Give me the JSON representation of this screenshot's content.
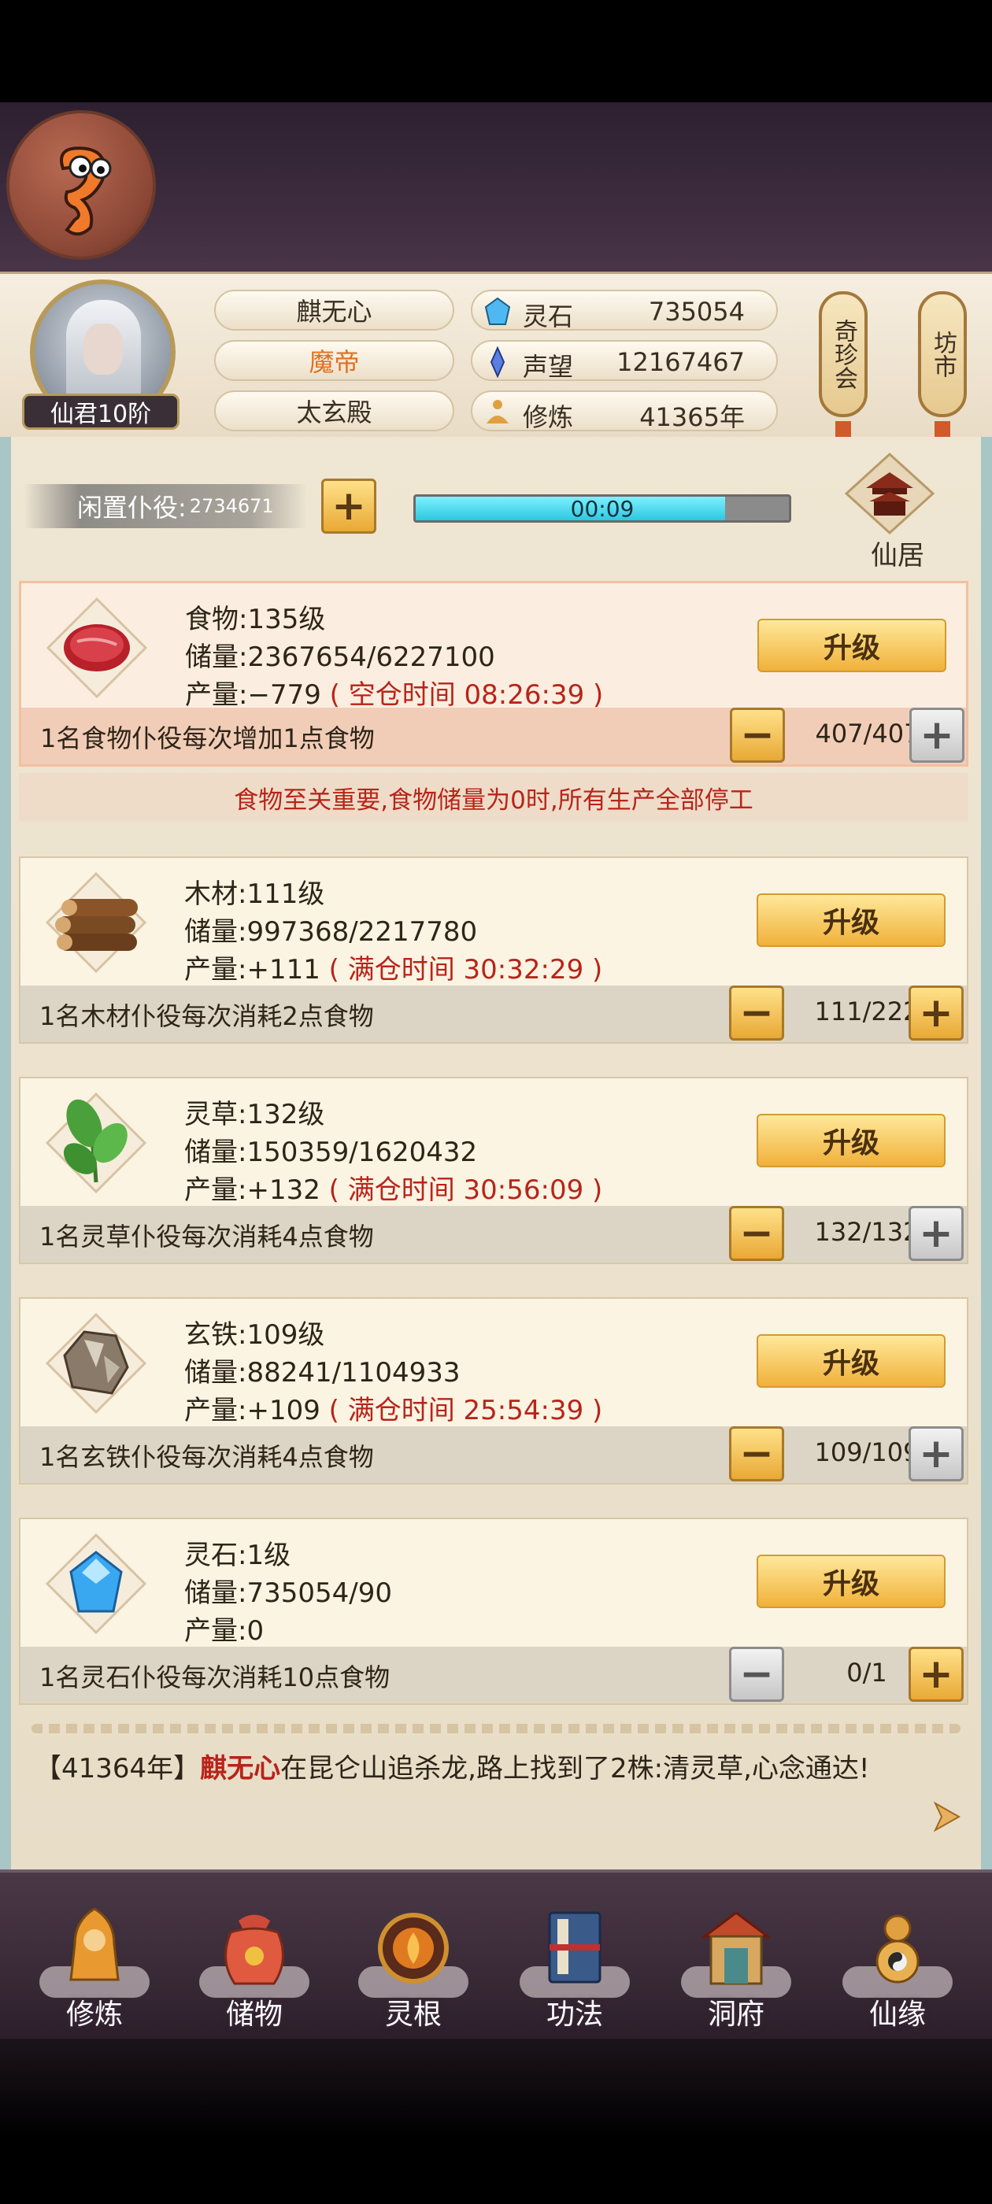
{
  "player": {
    "name": "麒无心",
    "title": "魔帝",
    "sect": "太玄殿",
    "rank": "仙君10阶"
  },
  "resources": [
    {
      "label": "灵石",
      "value": "735054",
      "icon": "spirit-stone-icon"
    },
    {
      "label": "声望",
      "value": "12167467",
      "icon": "fame-icon"
    },
    {
      "label": "修炼",
      "value": "41365年",
      "icon": "meditation-icon"
    }
  ],
  "side_buttons": {
    "qizhenhui": "奇珍会",
    "fangshi": "坊市"
  },
  "idle": {
    "label": "闲置仆役:",
    "count": "2734671",
    "timer": "00:09",
    "progress": 0.83
  },
  "xianju": {
    "label": "仙居"
  },
  "upgrade_label": "升级",
  "cards": [
    {
      "key": "food",
      "icon": "meat-icon",
      "name_line": "食物:135级",
      "storage_line": "储量:2367654/6227100",
      "output_prefix": "产量:−779",
      "output_note": "( 空仓时间 08:26:39 )",
      "desc": "1名食物仆役每次增加1点食物",
      "count": "407/407",
      "minus_enabled": true,
      "plus_enabled": false
    },
    {
      "key": "wood",
      "icon": "wood-logs-icon",
      "name_line": "木材:111级",
      "storage_line": "储量:997368/2217780",
      "output_prefix": "产量:+111",
      "output_note": "( 满仓时间 30:32:29 )",
      "desc": "1名木材仆役每次消耗2点食物",
      "count": "111/222",
      "minus_enabled": true,
      "plus_enabled": true
    },
    {
      "key": "herb",
      "icon": "herb-leaf-icon",
      "name_line": "灵草:132级",
      "storage_line": "储量:150359/1620432",
      "output_prefix": "产量:+132",
      "output_note": "( 满仓时间 30:56:09 )",
      "desc": "1名灵草仆役每次消耗4点食物",
      "count": "132/132",
      "minus_enabled": true,
      "plus_enabled": false
    },
    {
      "key": "iron",
      "icon": "iron-ore-icon",
      "name_line": "玄铁:109级",
      "storage_line": "储量:88241/1104933",
      "output_prefix": "产量:+109",
      "output_note": "( 满仓时间 25:54:39 )",
      "desc": "1名玄铁仆役每次消耗4点食物",
      "count": "109/109",
      "minus_enabled": true,
      "plus_enabled": false
    },
    {
      "key": "stone",
      "icon": "spirit-crystal-icon",
      "name_line": "灵石:1级",
      "storage_line": "储量:735054/90",
      "output_prefix": "产量:0",
      "output_note": "",
      "desc": "1名灵石仆役每次消耗10点食物",
      "count": "0/1",
      "minus_enabled": false,
      "plus_enabled": true
    }
  ],
  "food_notice": "食物至关重要,食物储量为0时,所有生产全部停工",
  "log": {
    "year": "【41364年】",
    "name": "麒无心",
    "text": "在昆仑山追杀龙,路上找到了2株:清灵草,心念通达!"
  },
  "nav": [
    {
      "label": "修炼",
      "icon": "cultivate-icon"
    },
    {
      "label": "储物",
      "icon": "storage-bag-icon"
    },
    {
      "label": "灵根",
      "icon": "spirit-root-icon"
    },
    {
      "label": "功法",
      "icon": "technique-book-icon"
    },
    {
      "label": "洞府",
      "icon": "cave-dwelling-icon"
    },
    {
      "label": "仙缘",
      "icon": "fate-gourd-icon"
    }
  ],
  "colors": {
    "accent_red": "#b8241a",
    "gold_button": "#f0b13a",
    "progress_cyan": "#2cc8e0"
  }
}
